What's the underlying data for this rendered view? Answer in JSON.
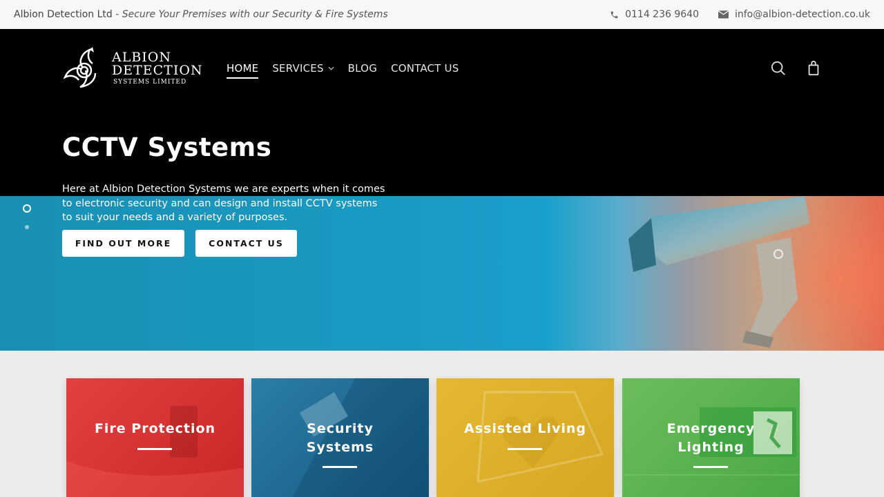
{
  "topbar": {
    "company": "Albion Detection Ltd",
    "separator": " - ",
    "tagline": "Secure Your Premises with our Security & Fire Systems",
    "phone": "0114 236 9640",
    "email": "info@albion-detection.co.uk"
  },
  "logo": {
    "line1": "ALBION",
    "line2": "DETECTION",
    "line3": "SYSTEMS LIMITED"
  },
  "nav": {
    "home": "HOME",
    "services": "SERVICES",
    "blog": "BLOG",
    "contact": "CONTACT US"
  },
  "hero": {
    "title": "CCTV Systems",
    "description": "Here at Albion Detection Systems we are experts when it comes to electronic security and can design and install CCTV systems to suit your needs and a variety of purposes.",
    "button_primary": "FIND OUT MORE",
    "button_secondary": "CONTACT US"
  },
  "services": [
    {
      "title": "Fire Protection",
      "color": "#d83232"
    },
    {
      "title": "Security Systems",
      "color": "#1f6a94"
    },
    {
      "title": "Assisted Living",
      "color": "#e0b02b"
    },
    {
      "title": "Emergency Lighting",
      "color": "#5db44f"
    }
  ],
  "icons": {
    "phone": "phone-icon",
    "email": "envelope-icon",
    "search": "search-icon",
    "cart": "shopping-bag-icon",
    "chevron": "chevron-down-icon"
  }
}
